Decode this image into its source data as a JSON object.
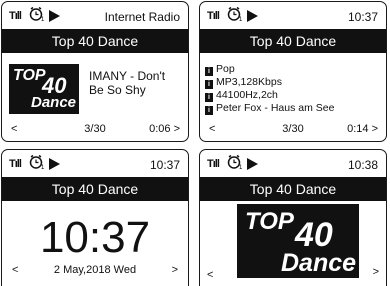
{
  "status": {
    "signal": "Tıll",
    "alarm_badge": "1"
  },
  "screens": [
    {
      "right_label": "Internet Radio",
      "station": "Top 40 Dance",
      "logo": {
        "top": "TOP",
        "num": "40",
        "word": "Dance"
      },
      "song": "IMANY - Don't Be So Shy",
      "nav_prev": "<",
      "position": "3/30",
      "elapsed": "0:06 >"
    },
    {
      "right_label": "10:37",
      "station": "Top 40 Dance",
      "info": [
        "Pop",
        "MP3,128Kbps",
        "44100Hz,2ch",
        "Peter Fox - Haus am See"
      ],
      "nav_prev": "<",
      "position": "3/30",
      "elapsed": "0:14 >"
    },
    {
      "right_label": "10:37",
      "station": "Top 40 Dance",
      "clock": "10:37",
      "date": "2 May,2018 Wed",
      "nav_prev": "<",
      "nav_next": ">"
    },
    {
      "right_label": "10:38",
      "station": "Top 40 Dance",
      "logo": {
        "top": "TOP",
        "num": "40",
        "word": "Dance"
      },
      "nav_prev": "<",
      "nav_next": ">"
    }
  ]
}
